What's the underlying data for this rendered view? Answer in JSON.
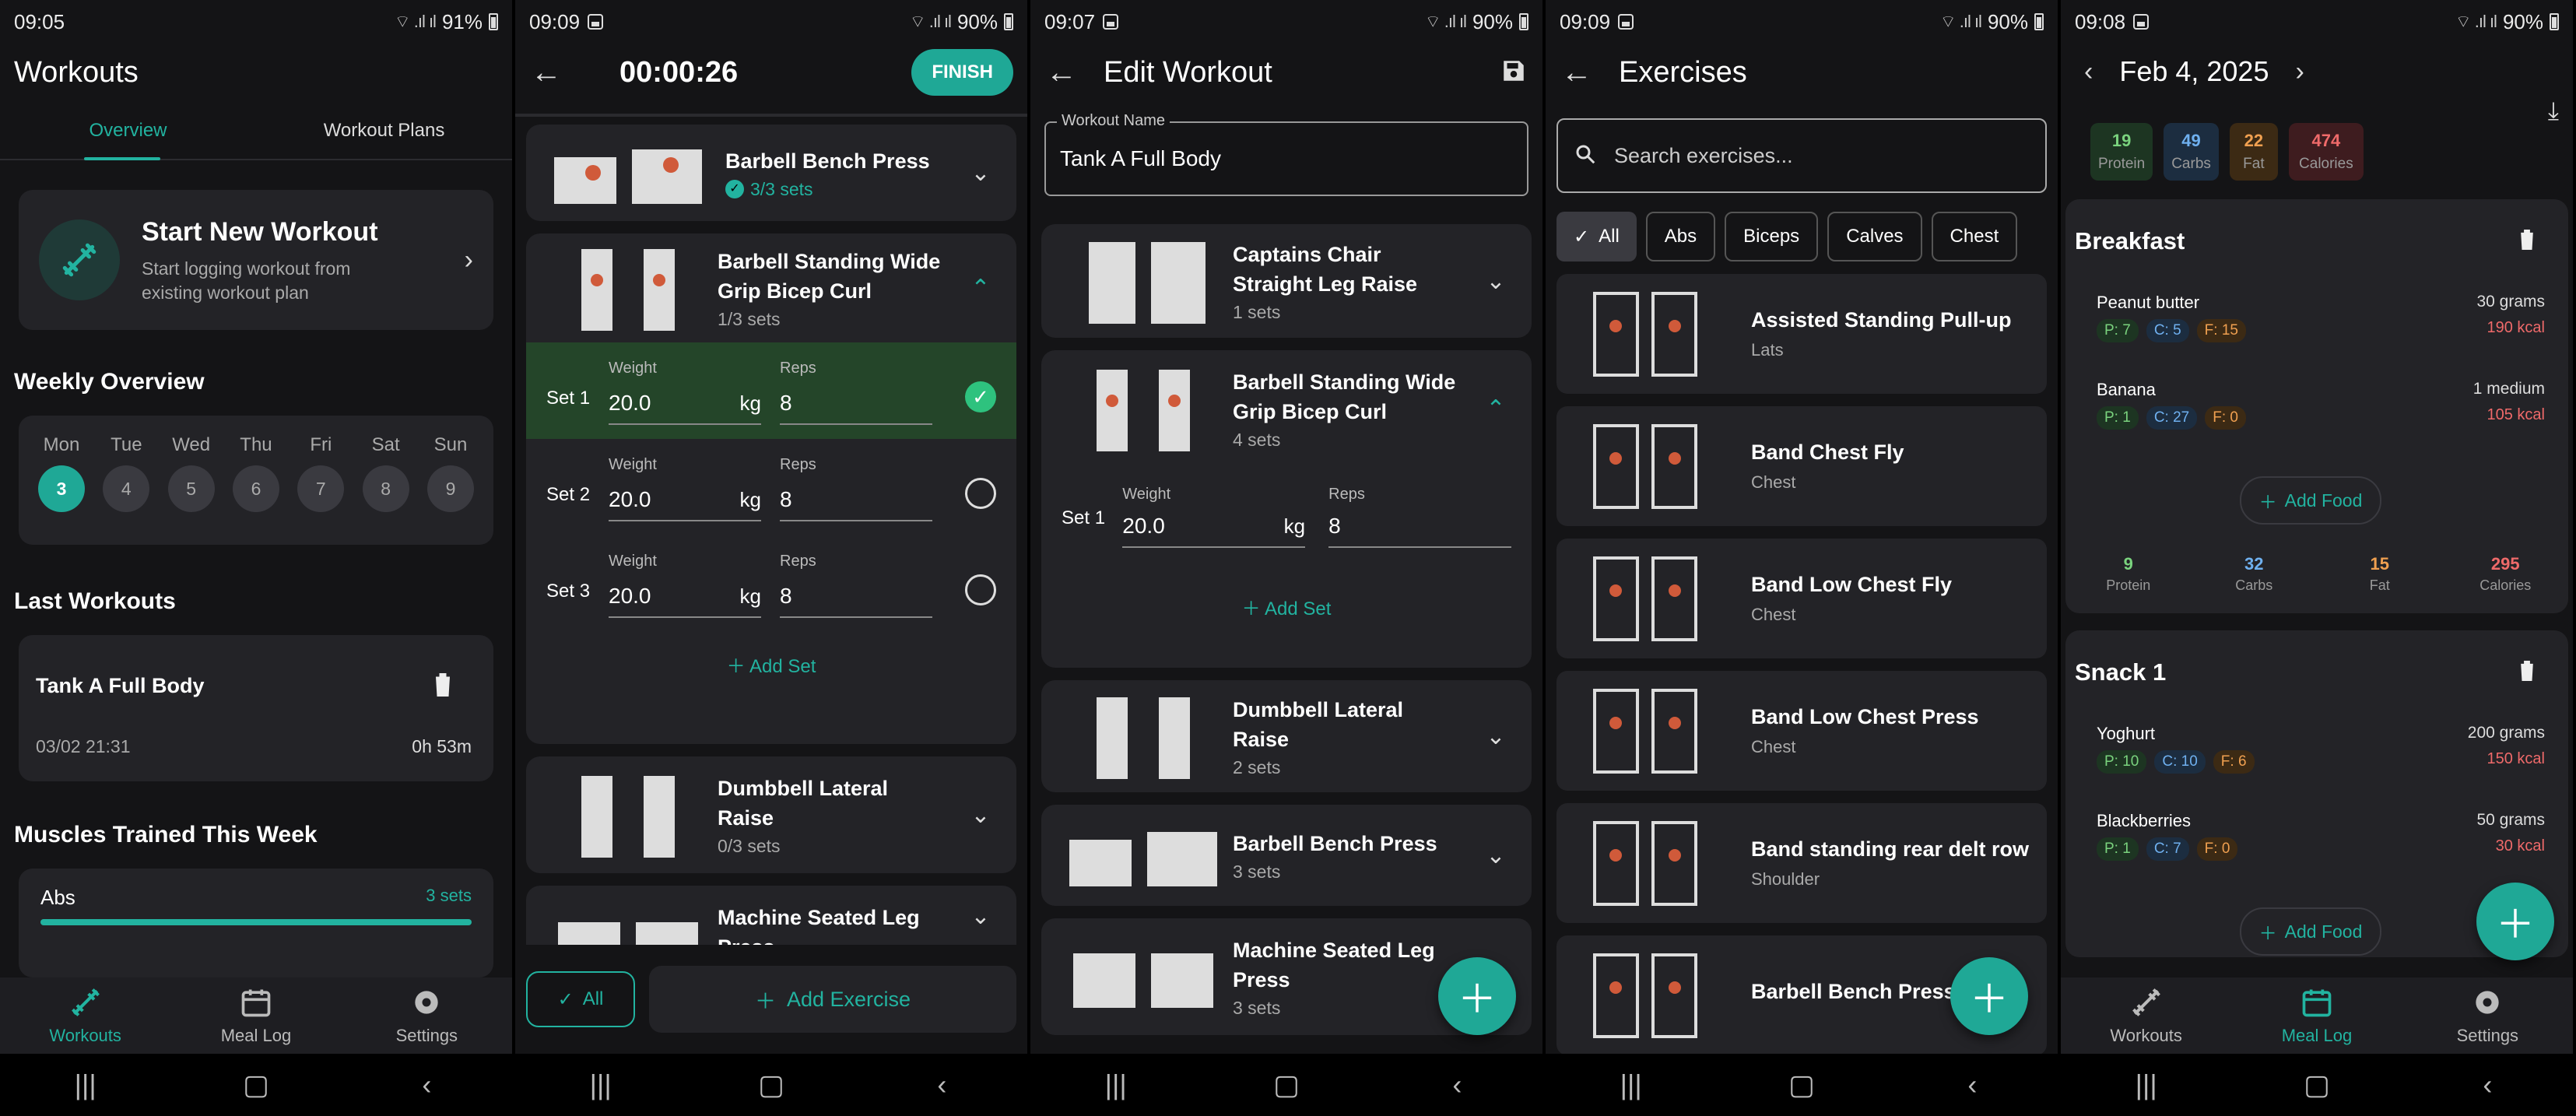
{
  "colors": {
    "accent": "#22b3a0",
    "bg": "#141416",
    "card": "#232327"
  },
  "p1": {
    "status": {
      "time": "09:05",
      "battery": "91%"
    },
    "title": "Workouts",
    "tabs": [
      "Overview",
      "Workout Plans"
    ],
    "start": {
      "title": "Start New Workout",
      "sub1": "Start logging workout from",
      "sub2": "existing workout plan"
    },
    "weekly_title": "Weekly Overview",
    "days": [
      {
        "d": "Mon",
        "n": "3"
      },
      {
        "d": "Tue",
        "n": "4"
      },
      {
        "d": "Wed",
        "n": "5"
      },
      {
        "d": "Thu",
        "n": "6"
      },
      {
        "d": "Fri",
        "n": "7"
      },
      {
        "d": "Sat",
        "n": "8"
      },
      {
        "d": "Sun",
        "n": "9"
      }
    ],
    "last_title": "Last Workouts",
    "last": {
      "name": "Tank A Full Body",
      "date": "03/02 21:31",
      "duration": "0h 53m"
    },
    "muscles_title": "Muscles Trained This Week",
    "muscle": {
      "name": "Abs",
      "sets": "3 sets",
      "progress": 1.0
    },
    "nav": [
      "Workouts",
      "Meal Log",
      "Settings"
    ]
  },
  "p2": {
    "status": {
      "time": "09:09",
      "battery": "90%"
    },
    "timer": "00:00:26",
    "finish": "FINISH",
    "ex1": {
      "name": "Barbell Bench Press",
      "sets": "3/3 sets"
    },
    "ex2": {
      "name1": "Barbell Standing Wide",
      "name2": "Grip Bicep Curl",
      "sets": "1/3 sets"
    },
    "sets": [
      {
        "label": "Set 1",
        "weight": "20.0",
        "reps": "8",
        "done": true
      },
      {
        "label": "Set 2",
        "weight": "20.0",
        "reps": "8",
        "done": false
      },
      {
        "label": "Set 3",
        "weight": "20.0",
        "reps": "8",
        "done": false
      }
    ],
    "weight_label": "Weight",
    "reps_label": "Reps",
    "unit": "kg",
    "add_set": "Add Set",
    "ex3": {
      "name1": "Dumbbell Lateral",
      "name2": "Raise",
      "sets": "0/3 sets"
    },
    "ex4": {
      "name1": "Machine Seated Leg",
      "name2": "Press"
    },
    "all": "All",
    "add_exercise": "Add Exercise"
  },
  "p3": {
    "status": {
      "time": "09:07",
      "battery": "90%"
    },
    "title": "Edit Workout",
    "name_label": "Workout Name",
    "name_value": "Tank A Full Body",
    "ex1": {
      "name1": "Captains Chair",
      "name2": "Straight Leg Raise",
      "sets": "1 sets"
    },
    "ex2": {
      "name1": "Barbell Standing Wide",
      "name2": "Grip Bicep Curl",
      "sets": "4 sets"
    },
    "set1": {
      "label": "Set 1",
      "weight": "20.0",
      "reps": "8"
    },
    "weight_label": "Weight",
    "reps_label": "Reps",
    "unit": "kg",
    "add_set": "Add Set",
    "ex3": {
      "name1": "Dumbbell Lateral",
      "name2": "Raise",
      "sets": "2 sets"
    },
    "ex4": {
      "name": "Barbell Bench Press",
      "sets": "3 sets"
    },
    "ex5": {
      "name1": "Machine Seated Leg",
      "name2": "Press",
      "sets": "3 sets"
    }
  },
  "p4": {
    "status": {
      "time": "09:09",
      "battery": "90%"
    },
    "title": "Exercises",
    "search_placeholder": "Search exercises...",
    "filters": [
      "All",
      "Abs",
      "Biceps",
      "Calves",
      "Chest"
    ],
    "items": [
      {
        "name": "Assisted Standing Pull-up",
        "muscle": "Lats"
      },
      {
        "name": "Band Chest Fly",
        "muscle": "Chest"
      },
      {
        "name": "Band Low Chest Fly",
        "muscle": "Chest"
      },
      {
        "name": "Band Low Chest Press",
        "muscle": "Chest"
      },
      {
        "name": "Band standing rear delt row",
        "muscle": "Shoulder"
      },
      {
        "name": "Barbell Bench Press",
        "muscle": ""
      }
    ]
  },
  "p5": {
    "status": {
      "time": "09:08",
      "battery": "90%"
    },
    "date": "Feb 4, 2025",
    "totals": [
      {
        "v": "19",
        "l": "Protein",
        "c": "#7ad37e",
        "bg": "#1d3522"
      },
      {
        "v": "49",
        "l": "Carbs",
        "c": "#6fb0ef",
        "bg": "#1c2d40"
      },
      {
        "v": "22",
        "l": "Fat",
        "c": "#f0a050",
        "bg": "#3c2a14"
      },
      {
        "v": "474",
        "l": "Calories",
        "c": "#ef6a6a",
        "bg": "#3e1c1f"
      }
    ],
    "breakfast": {
      "title": "Breakfast",
      "foods": [
        {
          "name": "Peanut butter",
          "qty": "30 grams",
          "kcal": "190 kcal",
          "p": "P: 7",
          "c": "C: 5",
          "f": "F: 15"
        },
        {
          "name": "Banana",
          "qty": "1 medium",
          "kcal": "105 kcal",
          "p": "P: 1",
          "c": "C: 27",
          "f": "F: 0"
        }
      ],
      "sum": [
        {
          "v": "9",
          "l": "Protein"
        },
        {
          "v": "32",
          "l": "Carbs"
        },
        {
          "v": "15",
          "l": "Fat"
        },
        {
          "v": "295",
          "l": "Calories"
        }
      ]
    },
    "snack": {
      "title": "Snack 1",
      "foods": [
        {
          "name": "Yoghurt",
          "qty": "200 grams",
          "kcal": "150 kcal",
          "p": "P: 10",
          "c": "C: 10",
          "f": "F: 6"
        },
        {
          "name": "Blackberries",
          "qty": "50 grams",
          "kcal": "30 kcal",
          "p": "P: 1",
          "c": "C: 7",
          "f": "F: 0"
        }
      ]
    },
    "add_food": "Add Food",
    "nav": [
      "Workouts",
      "Meal Log",
      "Settings"
    ]
  }
}
